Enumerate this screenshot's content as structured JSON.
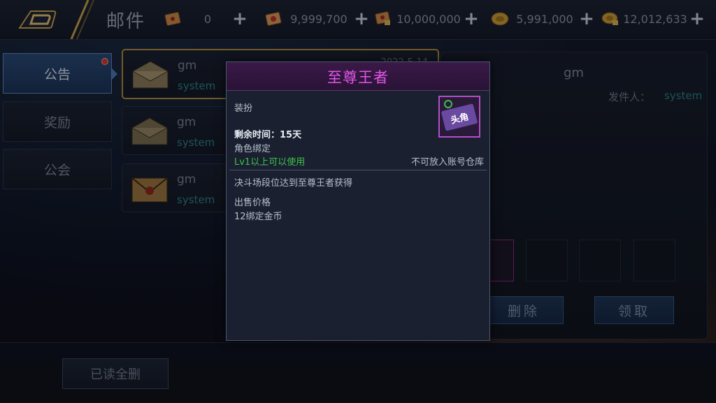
{
  "title": "邮件",
  "currencies": [
    {
      "icon": "ticket-scroll-icon",
      "value": "0"
    },
    {
      "icon": "red-scroll-icon",
      "value": "9,999,700"
    },
    {
      "icon": "locked-scroll-icon",
      "value": "10,000,000"
    },
    {
      "icon": "gold-coin-icon",
      "value": "5,991,000"
    },
    {
      "icon": "locked-coin-icon",
      "value": "12,012,633"
    }
  ],
  "plus_label": "+",
  "tabs": [
    {
      "label": "公告",
      "active": true,
      "has_dot": true
    },
    {
      "label": "奖励",
      "active": false
    },
    {
      "label": "公会",
      "active": false
    }
  ],
  "mails": [
    {
      "sender": "gm",
      "sender_type": "system",
      "date": "2022-5-14",
      "selected": true
    },
    {
      "sender": "gm",
      "sender_type": "system"
    },
    {
      "sender": "gm",
      "sender_type": "system"
    }
  ],
  "detail": {
    "sender": "gm",
    "from_label": "发件人：",
    "from_value": "system",
    "delete_label": "删除",
    "claim_label": "领取"
  },
  "bottom": {
    "delete_read_label": "已读全删"
  },
  "tooltip": {
    "title": "至尊王者",
    "type": "装扮",
    "remaining_time": "剩余时间：15天",
    "bind": "角色绑定",
    "level_req": "Lv1以上可以使用",
    "warehouse": "不可放入账号仓库",
    "source": "决斗场段位达到至尊王者获得",
    "price_label": "出售价格",
    "price": "12绑定金币",
    "item_icon": "headwear-card-icon",
    "item_icon_text": "头角"
  },
  "colors": {
    "title_purple": "#e255e8",
    "green_text": "#3fc04a",
    "system_teal": "#2f7f8a",
    "selected_border": "#b38a3c",
    "notification_red": "#d23a2e"
  }
}
